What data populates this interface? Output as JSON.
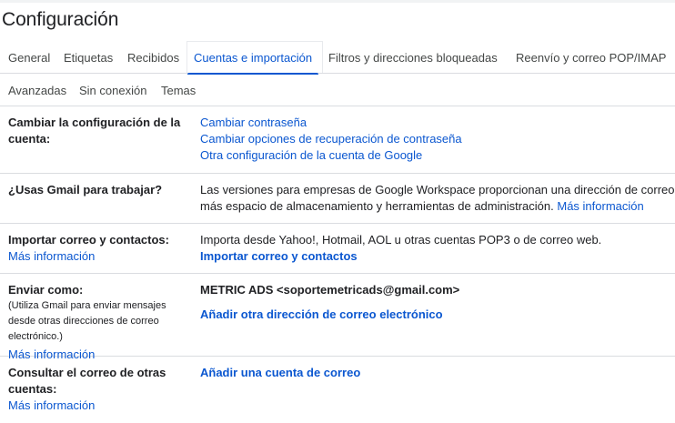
{
  "page": {
    "title": "Configuración"
  },
  "tabs_row1": [
    {
      "label": "General"
    },
    {
      "label": "Etiquetas"
    },
    {
      "label": "Recibidos"
    },
    {
      "label": "Cuentas e importación"
    },
    {
      "label": "Filtros y direcciones bloqueadas"
    },
    {
      "label": "Reenvío y correo POP/IMAP"
    }
  ],
  "tabs_row2": [
    {
      "label": "Avanzadas"
    },
    {
      "label": "Sin conexión"
    },
    {
      "label": "Temas"
    }
  ],
  "sections": {
    "account": {
      "label": "Cambiar la configuración de la cuenta:",
      "links": [
        "Cambiar contraseña",
        "Cambiar opciones de recuperación de contraseña",
        "Otra configuración de la cuenta de Google"
      ]
    },
    "work": {
      "label": "¿Usas Gmail para trabajar?",
      "line1": "Las versiones para empresas de Google Workspace proporcionan una dirección de correo p",
      "line2": "más espacio de almacenamiento y herramientas de administración.",
      "link": "Más información"
    },
    "import": {
      "label": "Importar correo y contactos:",
      "more": "Más información",
      "text": "Importa desde Yahoo!, Hotmail, AOL u otras cuentas POP3 o de correo web.",
      "action": "Importar correo y contactos"
    },
    "send_as": {
      "label": "Enviar como:",
      "note": "(Utiliza Gmail para enviar mensajes desde otras direcciones de correo electrónico.)",
      "more": "Más información",
      "address": "METRIC ADS <soportemetricads@gmail.com>",
      "action": "Añadir otra dirección de correo electrónico"
    },
    "check_mail": {
      "label": "Consultar el correo de otras cuentas:",
      "more": "Más información",
      "action": "Añadir una cuenta de correo"
    }
  }
}
